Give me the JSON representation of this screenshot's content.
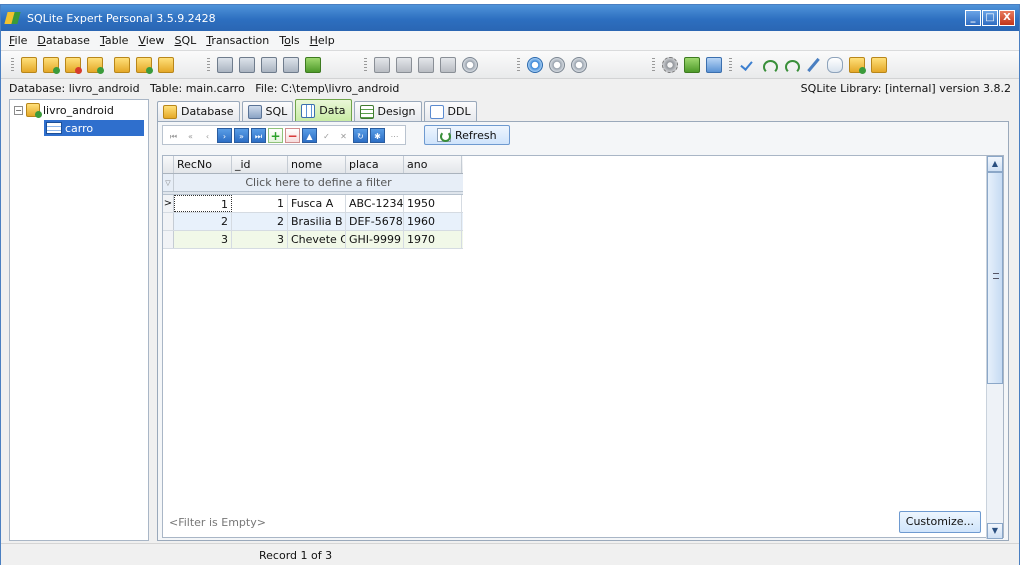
{
  "window": {
    "title": "SQLite Expert Personal 3.5.9.2428",
    "buttons": {
      "minimize": "_",
      "maximize": "□",
      "close": "X"
    }
  },
  "menu": [
    {
      "label": "File",
      "u": "F",
      "rest": "ile"
    },
    {
      "label": "Database",
      "u": "D",
      "rest": "atabase"
    },
    {
      "label": "Table",
      "u": "T",
      "rest": "able"
    },
    {
      "label": "View",
      "u": "V",
      "rest": "iew"
    },
    {
      "label": "SQL",
      "u": "S",
      "rest": "QL"
    },
    {
      "label": "Transaction",
      "u": "T",
      "rest": "ransaction"
    },
    {
      "label": "Tools",
      "u": "T",
      "rest": "o",
      "u2": "o",
      "rest2": "ls"
    },
    {
      "label": "Help",
      "u": "H",
      "rest": "elp"
    }
  ],
  "info": {
    "left": "Database: livro_android   Table: main.carro   File: C:\\temp\\livro_android",
    "right": "SQLite Library: [internal] version 3.8.2"
  },
  "tree": {
    "root": "livro_android",
    "toggle": "−",
    "child": "carro"
  },
  "tabs": [
    "Database",
    "SQL",
    "Data",
    "Design",
    "DDL"
  ],
  "nav": {
    "first": "⏮",
    "prior_page": "«",
    "prior": "‹",
    "next": "›",
    "next_page": "»",
    "last": "⏭",
    "insert": "+",
    "delete": "−",
    "up": "▲",
    "post": "✓",
    "cancel": "✕",
    "refresh": "↻",
    "apply": "✱",
    "filter": "⋯"
  },
  "refresh_label": "Refresh",
  "grid": {
    "columns": [
      "RecNo",
      "_id",
      "nome",
      "placa",
      "ano"
    ],
    "filter_hint": "Click here to define a filter",
    "filter_icon": "▽",
    "rows": [
      {
        "indicator": ">",
        "recno": "1",
        "id": "1",
        "nome": "Fusca A",
        "placa": "ABC-1234",
        "ano": "1950"
      },
      {
        "indicator": "",
        "recno": "2",
        "id": "2",
        "nome": "Brasilia B",
        "placa": "DEF-5678",
        "ano": "1960"
      },
      {
        "indicator": "",
        "recno": "3",
        "id": "3",
        "nome": "Chevete C",
        "placa": "GHI-9999",
        "ano": "1970"
      }
    ]
  },
  "scrollbar": {
    "up": "▲",
    "down": "▼"
  },
  "filter_status": "<Filter is Empty>",
  "customize_label": "Customize...",
  "status": "Record 1 of 3"
}
